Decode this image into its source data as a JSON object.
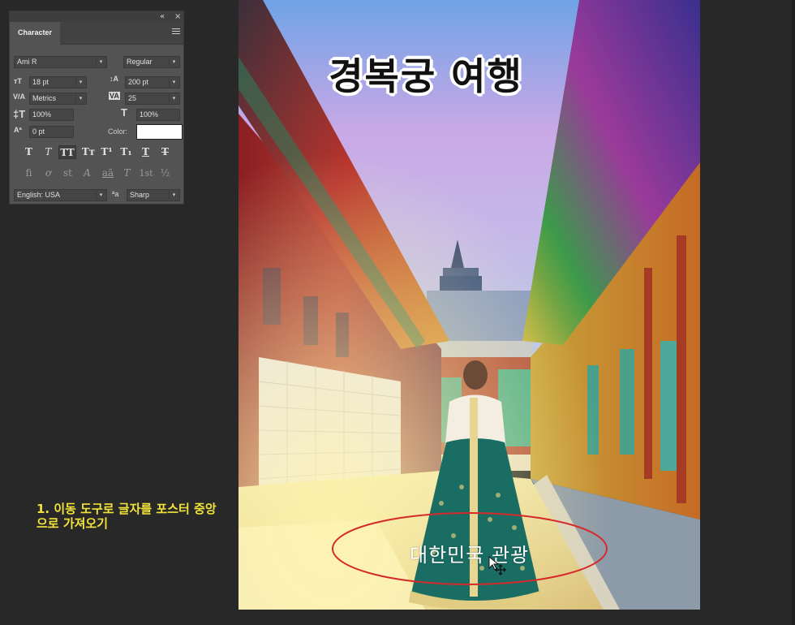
{
  "panel": {
    "collapse_icon": "«",
    "close_icon": "×",
    "tab_label": "Character",
    "font_family": "Ami R",
    "font_style": "Regular",
    "font_size": "18 pt",
    "leading": "200 pt",
    "kerning": "Metrics",
    "tracking": "25",
    "vertical_scale": "100%",
    "horizontal_scale": "100%",
    "baseline_shift": "0 pt",
    "color_label": "Color:",
    "color_value": "#ffffff",
    "style_buttons": [
      "T",
      "T",
      "TT",
      "Tт",
      "T¹",
      "T₁",
      "T",
      "T"
    ],
    "opentype_buttons": [
      "fi",
      "ơ",
      "st",
      "A",
      "aā",
      "T",
      "1st",
      "½"
    ],
    "language": "English: USA",
    "aa_icon": "ªa",
    "antialias": "Sharp"
  },
  "poster": {
    "title": "경복궁 여행",
    "subtitle": "대한민국 관광"
  },
  "instruction": {
    "text": "1. 이동 도구로 글자를 포스터 중앙으로 가져오기"
  }
}
